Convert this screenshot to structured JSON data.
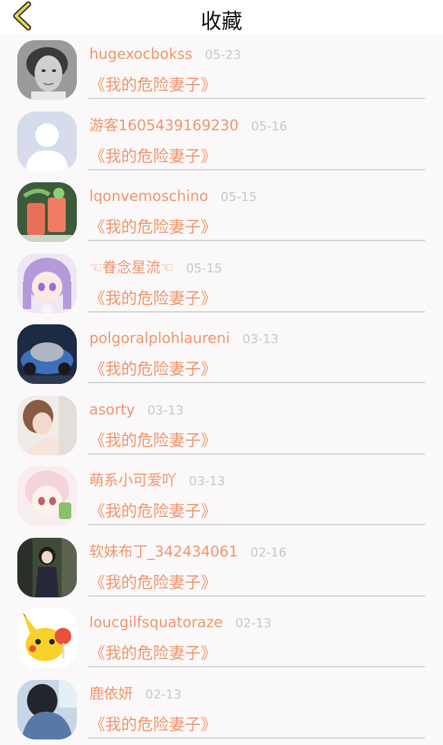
{
  "header": {
    "title": "收藏"
  },
  "colors": {
    "accent": "#f0956a",
    "date": "#c8c8c8",
    "back_icon": "#e8d44a"
  },
  "favorites": [
    {
      "user": "hugexocboks s",
      "date": "05-23",
      "work": "《我的危险妻子》",
      "avatar": "boy-portrait-avatar"
    },
    {
      "user": "游客1605439169230",
      "date": "05-16",
      "work": "《我的危险妻子》",
      "avatar": "default-user-avatar"
    },
    {
      "user": "lqonvemoschino",
      "date": "05-15",
      "work": "《我的危险妻子》",
      "avatar": "drinks-avatar"
    },
    {
      "user": "☜眷念星流☜",
      "date": "05-15",
      "work": "《我的危险妻子》",
      "avatar": "anime-girl-purple-avatar"
    },
    {
      "user": "polgoralplohlaureni",
      "date": "03-13",
      "work": "《我的危险妻子》",
      "avatar": "concept-car-avatar"
    },
    {
      "user": "asorty",
      "date": "03-13",
      "work": "《我的危险妻子》",
      "avatar": "woman-photo-avatar"
    },
    {
      "user": "萌系小可爱吖",
      "date": "03-13",
      "work": "《我的危险妻子》",
      "avatar": "anime-girl-pink-avatar"
    },
    {
      "user": "软妹布丁_342434061",
      "date": "02-16",
      "work": "《我的危险妻子》",
      "avatar": "girl-street-avatar"
    },
    {
      "user": "loucgilfsquatoraze",
      "date": "02-13",
      "work": "《我的危险妻子》",
      "avatar": "pikachu-avatar"
    },
    {
      "user": "鹿依妍",
      "date": "02-13",
      "work": "《我的危险妻子》",
      "avatar": "blue-hoodie-avatar"
    }
  ]
}
